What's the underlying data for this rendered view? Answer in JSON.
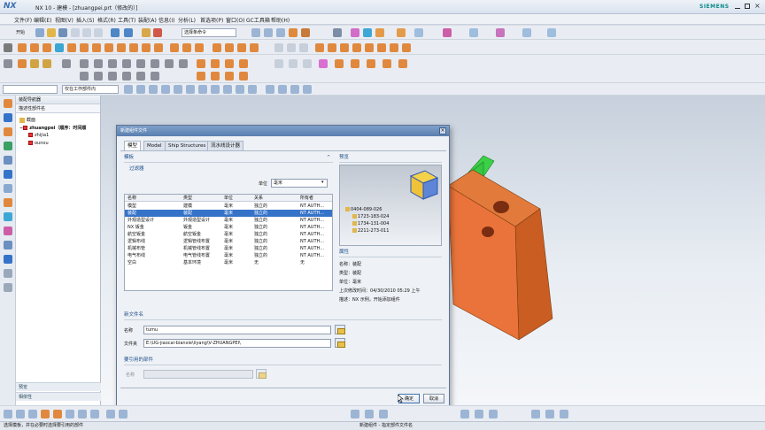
{
  "window": {
    "app_logo": "NX",
    "title": "NX 10 - 建模 - [zhuangpei.prt（修改的）]",
    "brand": "SIEMENS"
  },
  "menubar": [
    "文件(F)",
    "编辑(E)",
    "视图(V)",
    "插入(S)",
    "格式(R)",
    "工具(T)",
    "装配(A)",
    "信息(I)",
    "分析(L)",
    "首选项(P)",
    "窗口(O)",
    "GC工具箱",
    "帮助(H)"
  ],
  "toolbar": {
    "start_label": "开始",
    "select_filter": "选择条命令",
    "whole_assembly": "仅在工作部件内"
  },
  "navigator": {
    "title": "装配导航器",
    "column": "描述性部件名",
    "tree": [
      {
        "label": "截面",
        "level": 1
      },
      {
        "label": "zhuangpei（顺序：时间顺",
        "level": 1
      },
      {
        "label": "zhijia1",
        "level": 2
      },
      {
        "label": "ounou",
        "level": 2
      }
    ],
    "bottom_panels": [
      "预览",
      "相依性"
    ]
  },
  "dialog": {
    "title": "新建组件文件",
    "tabs": [
      "模型",
      "Model",
      "Ship Structures",
      "流水线设计器"
    ],
    "template_section": "模板",
    "filter_section": "过滤器",
    "unit_label": "单位",
    "unit_value": "毫米",
    "table_columns": [
      "名称",
      "类型",
      "单位",
      "关系",
      "所有者"
    ],
    "table_rows": [
      [
        "模型",
        "建模",
        "毫米",
        "独立的",
        "NT AUTH..."
      ],
      [
        "装配",
        "装配",
        "毫米",
        "独立的",
        "NT AUTH..."
      ],
      [
        "外观造型设计",
        "外观造型设计",
        "毫米",
        "独立的",
        "NT AUTH..."
      ],
      [
        "NX 钣金",
        "钣金",
        "毫米",
        "独立的",
        "NT AUTH..."
      ],
      [
        "航空钣金",
        "航空钣金",
        "毫米",
        "独立的",
        "NT AUTH..."
      ],
      [
        "逻辑布线",
        "逻辑管线布置",
        "毫米",
        "独立的",
        "NT AUTH..."
      ],
      [
        "机械布管",
        "机械管线布置",
        "毫米",
        "独立的",
        "NT AUTH..."
      ],
      [
        "电气布线",
        "电气管线布置",
        "毫米",
        "独立的",
        "NT AUTH..."
      ],
      [
        "空白",
        "基本环境",
        "毫米",
        "无",
        "无"
      ]
    ],
    "selected_row": 1,
    "preview_section": "预览",
    "preview_tree": [
      "0404-089-026",
      "1723-183-024",
      "1734-131-004",
      "2211-273-011"
    ],
    "properties_section": "属性",
    "properties": [
      {
        "k": "名称",
        "v": "装配"
      },
      {
        "k": "类型",
        "v": "装配"
      },
      {
        "k": "单位",
        "v": "毫米"
      },
      {
        "k": "上次修改时间",
        "v": "04/30/2010 05:29 上午"
      },
      {
        "k": "描述",
        "v": "NX 示例，开始添加组件"
      }
    ],
    "new_file_section": "新文件名",
    "name_label": "名称",
    "name_value": "tumu",
    "folder_label": "文件夹",
    "folder_value": "E:\\UG-jiaocai-bianxie\\liyang\\V-ZHUANGPEI\\",
    "ref_section": "要引用的部件",
    "ref_name_label": "名称",
    "ok_label": "确定",
    "cancel_label": "取消"
  },
  "statusbar": {
    "left": "选择模板，并在必要时选择要引用的部件",
    "right": "新建组件 - 指定部件文件名"
  }
}
